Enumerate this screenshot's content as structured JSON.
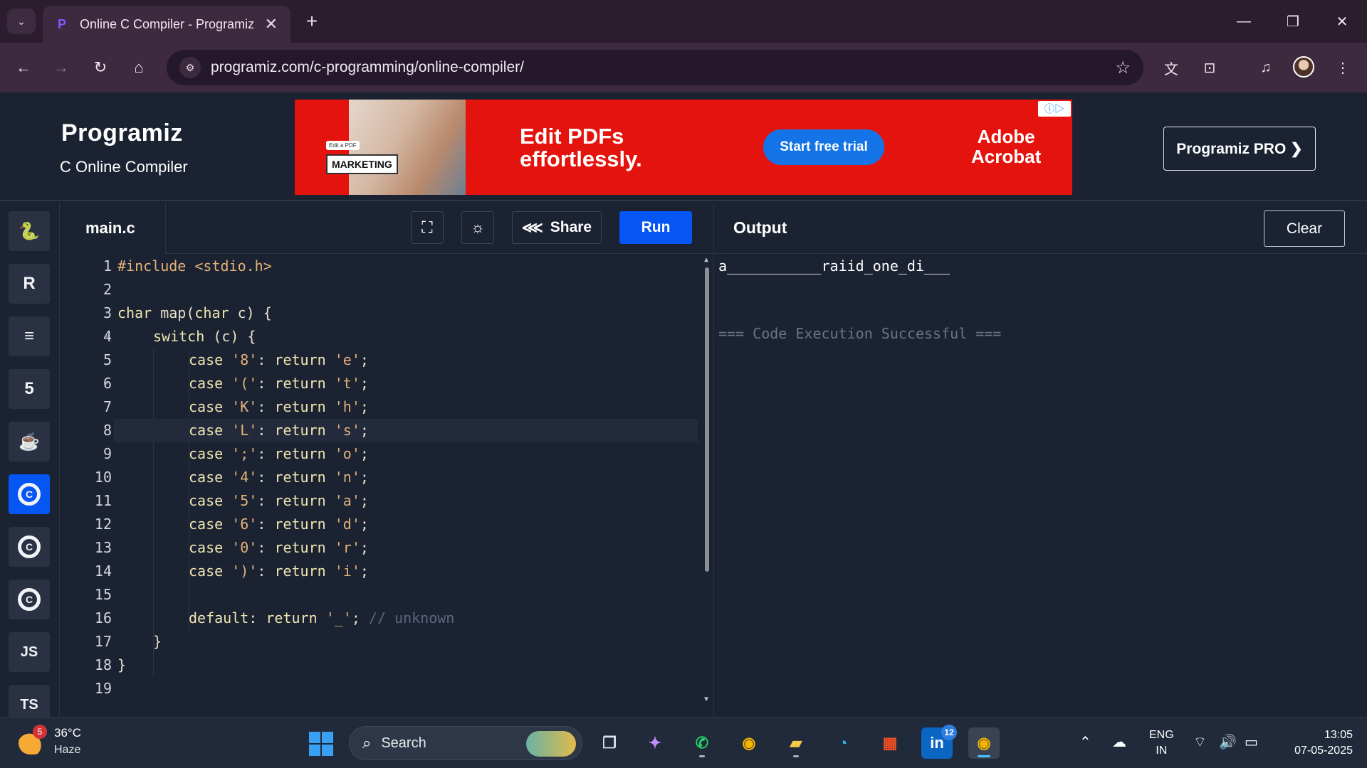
{
  "browser": {
    "tab_title": "Online C Compiler - Programiz",
    "url": "programiz.com/c-programming/online-compiler/",
    "new_tab": "+",
    "close_tab": "✕"
  },
  "site": {
    "logo": "Programiz",
    "subtitle": "C Online Compiler",
    "pro_button": "Programiz PRO ❯"
  },
  "ad": {
    "headline_line1": "Edit PDFs",
    "headline_line2": "effortlessly.",
    "cta": "Start free trial",
    "brand_line1": "Adobe",
    "brand_line2": "Acrobat",
    "badge": "MARKETING",
    "badge_small": "Edit a PDF"
  },
  "languages": [
    {
      "name": "python",
      "label": "🐍"
    },
    {
      "name": "r",
      "label": "R"
    },
    {
      "name": "sql",
      "label": "≡"
    },
    {
      "name": "html",
      "label": "5"
    },
    {
      "name": "java",
      "label": "☕"
    },
    {
      "name": "c",
      "label": "C"
    },
    {
      "name": "cpp",
      "label": "C"
    },
    {
      "name": "csharp",
      "label": "C"
    },
    {
      "name": "javascript",
      "label": "JS"
    },
    {
      "name": "typescript",
      "label": "TS"
    }
  ],
  "editor": {
    "filename": "main.c",
    "share_label": "Share",
    "run_label": "Run",
    "line_numbers": [
      "1",
      "2",
      "3",
      "4",
      "5",
      "6",
      "7",
      "8",
      "9",
      "10",
      "11",
      "12",
      "13",
      "14",
      "15",
      "16",
      "17",
      "18",
      "19"
    ],
    "code": {
      "l1_pp": "#include",
      "l1_hdr": " <stdio.h>",
      "l3_a": "char",
      "l3_b": " map(",
      "l3_c": "char",
      "l3_d": " c) {",
      "l4_a": "switch",
      "l4_b": " (c) {",
      "cases": [
        {
          "ch": "'8'",
          "ret": "'e'"
        },
        {
          "ch": "'('",
          "ret": "'t'"
        },
        {
          "ch": "'K'",
          "ret": "'h'"
        },
        {
          "ch": "'L'",
          "ret": "'s'"
        },
        {
          "ch": "';'",
          "ret": "'o'"
        },
        {
          "ch": "'4'",
          "ret": "'n'"
        },
        {
          "ch": "'5'",
          "ret": "'a'"
        },
        {
          "ch": "'6'",
          "ret": "'d'"
        },
        {
          "ch": "'0'",
          "ret": "'r'"
        },
        {
          "ch": "')'",
          "ret": "'i'"
        }
      ],
      "case_kw": "case",
      "return_kw": "return",
      "default_kw": "default",
      "default_ret": "'_'",
      "default_comment": "// unknown",
      "close_inner": "}",
      "close_outer": "}"
    }
  },
  "output": {
    "title": "Output",
    "clear_label": "Clear",
    "result": "a___________raiid_one_di___",
    "status": "=== Code Execution Successful ==="
  },
  "taskbar": {
    "weather_temp": "36°C",
    "weather_cond": "Haze",
    "weather_badge": "5",
    "search_label": "Search",
    "linkedin_badge": "12",
    "lang_line1": "ENG",
    "lang_line2": "IN",
    "time": "13:05",
    "date": "07-05-2025"
  },
  "colors": {
    "accent": "#0556f3",
    "ad_red": "#e4130d",
    "editor_bg": "#1b2232"
  }
}
